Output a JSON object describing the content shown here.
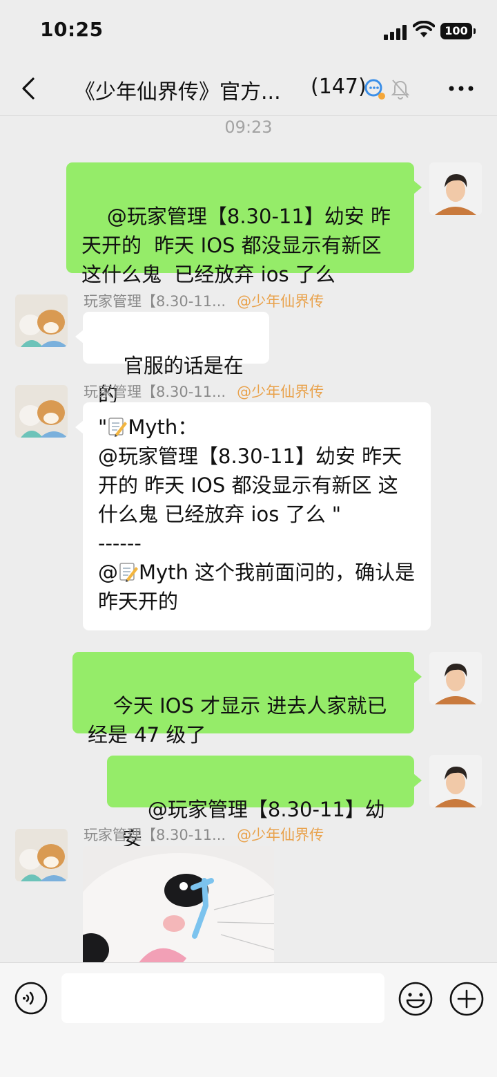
{
  "status_bar": {
    "time": "10:25",
    "battery": "100"
  },
  "header": {
    "title": "《少年仙界传》官方...",
    "member_count": "(147)"
  },
  "chat": {
    "timestamp": "09:23",
    "messages": [
      {
        "direction": "out",
        "text": "@玩家管理【8.30-11】幼安 昨天开的  昨天 IOS 都没显示有新区   这什么鬼  已经放弃 ios 了么"
      },
      {
        "direction": "in",
        "sender": "玩家管理【8.30-11...",
        "group_tag": "@少年仙界传",
        "text": "官服的话是在的"
      },
      {
        "direction": "in",
        "sender": "玩家管理【8.30-11...",
        "group_tag": "@少年仙界传",
        "quote_open": "\"",
        "quote_name": "Myth：",
        "quote_text": "@玩家管理【8.30-11】幼安 昨天开的  昨天 IOS 都没显示有新区   这什么鬼  已经放弃 ios 了么 \"",
        "divider": "------",
        "reply_prefix": "@",
        "reply_text": "Myth 这个我前面问的，确认是昨天开的"
      },
      {
        "direction": "out",
        "text": "今天 IOS 才显示 进去人家就已经是 47 级了"
      },
      {
        "direction": "out",
        "text": "@玩家管理【8.30-11】幼安"
      },
      {
        "direction": "in",
        "sender": "玩家管理【8.30-11...",
        "group_tag": "@少年仙界传",
        "type": "image"
      }
    ]
  },
  "input": {
    "value": ""
  },
  "colors": {
    "outgoing_bubble": "#95ec69",
    "incoming_bubble": "#ffffff",
    "background": "#ededed",
    "group_tag": "#e9a24c"
  },
  "icons": [
    "back-arrow-icon",
    "channels-icon",
    "mute-bell-icon",
    "more-dots-icon",
    "voice-icon",
    "emoji-icon",
    "plus-icon",
    "memo-emoji-icon"
  ]
}
